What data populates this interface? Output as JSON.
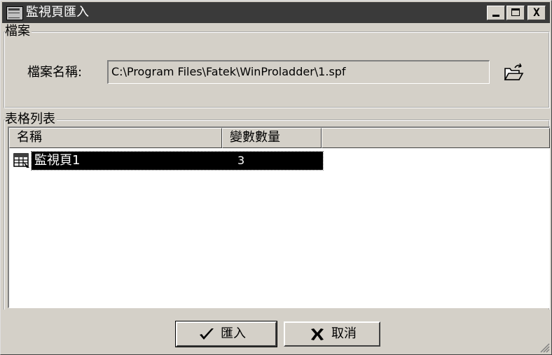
{
  "window": {
    "title": "監視頁匯入",
    "icon": "window-icon",
    "controls": [
      "minimize-icon",
      "maximize-icon",
      "close-icon"
    ],
    "close_label": "X"
  },
  "file_group": {
    "label": "檔案",
    "field_label": "檔案名稱:",
    "path_value": "C:\\Program Files\\Fatek\\WinProladder\\1.spf",
    "browse_icon": "folder-open-icon"
  },
  "table_group": {
    "label": "表格列表",
    "columns": [
      "名稱",
      "變數數量"
    ],
    "rows": [
      {
        "icon": "table-icon",
        "name": "監視頁1",
        "count": "3",
        "selected": true
      }
    ]
  },
  "buttons": {
    "import": {
      "label": "匯入",
      "icon": "checkmark-icon"
    },
    "cancel": {
      "label": "取消",
      "icon": "x-icon"
    }
  },
  "colors": {
    "titlebar": "#3a3a3a",
    "face": "#d4d0c8",
    "selection": "#000000"
  }
}
